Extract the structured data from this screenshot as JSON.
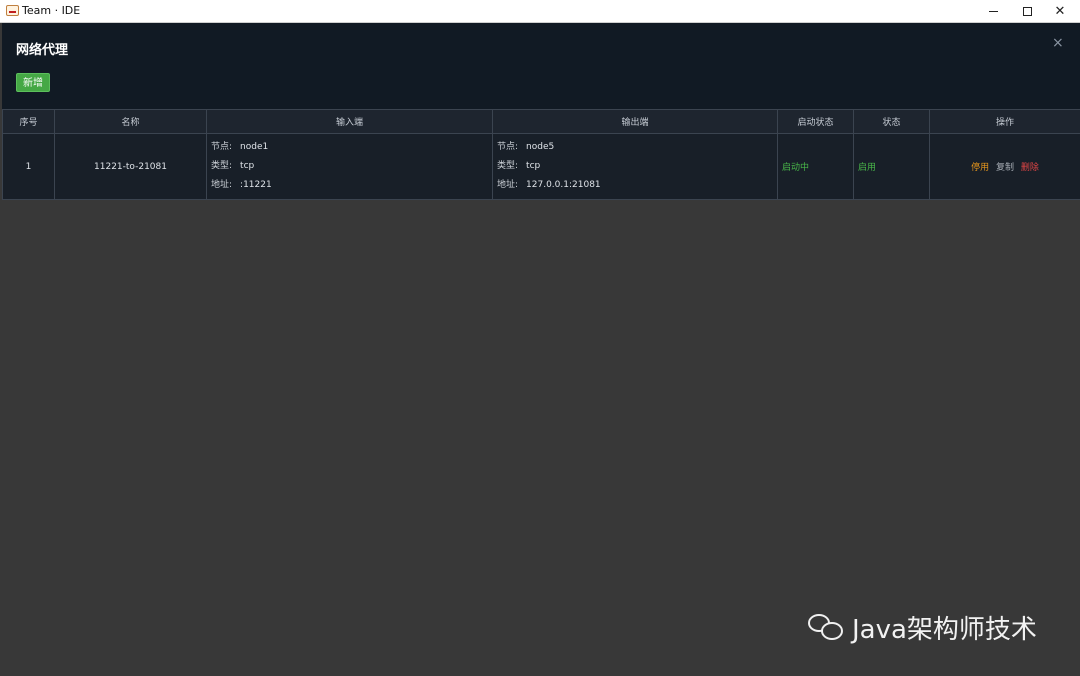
{
  "window": {
    "title": "Team · IDE",
    "close_glyph": "✕"
  },
  "panel": {
    "title": "网络代理",
    "close_glyph": "×",
    "add_label": "新增"
  },
  "table": {
    "columns": [
      "序号",
      "名称",
      "输入端",
      "输出端",
      "启动状态",
      "状态",
      "操作"
    ],
    "rows": [
      {
        "index": "1",
        "name": "11221-to-21081",
        "input": {
          "node_key": "节点:",
          "node": "node1",
          "type_key": "类型:",
          "type": "tcp",
          "addr_key": "地址:",
          "addr": ":11221"
        },
        "output": {
          "node_key": "节点:",
          "node": "node5",
          "type_key": "类型:",
          "type": "tcp",
          "addr_key": "地址:",
          "addr": "127.0.0.1:21081"
        },
        "run_status": "启动中",
        "status": "启用",
        "actions": {
          "stop": "停用",
          "copy": "复制",
          "delete": "删除"
        }
      }
    ]
  },
  "watermark": {
    "text": "Java架构师技术",
    "icon": "wechat-icon"
  },
  "colors": {
    "accent_green": "#45a845",
    "stop_orange": "#e6961c",
    "delete_red": "#e04545",
    "panel_bg": "#111a24"
  }
}
